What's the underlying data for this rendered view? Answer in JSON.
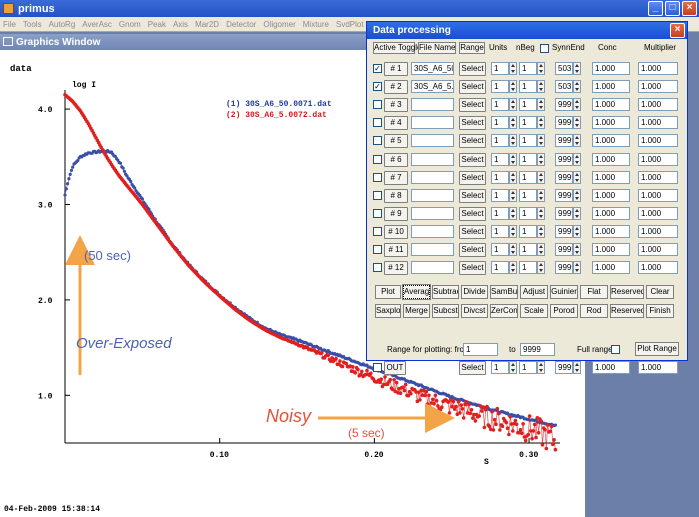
{
  "window": {
    "title": "primus"
  },
  "menu": [
    "File",
    "Tools",
    "AutoRg",
    "AverAsc",
    "Gnom",
    "Peak",
    "Axis",
    "Mar2D",
    "Detector",
    "Oligomer",
    "Mixture",
    "SvdPlot",
    "Bodies",
    "Save"
  ],
  "graphics": {
    "title": "Graphics Window",
    "data_label": "data",
    "log_label": "log I",
    "datetime": "04-Feb-2009   15:38:14",
    "legend": [
      {
        "text": "(1) 30S_A6_50.0071.dat",
        "color": "#1f3aa0"
      },
      {
        "text": "(2) 30S_A6_5.0072.dat",
        "color": "#d01818"
      }
    ],
    "annotations": {
      "exposure_long": "(50 sec)",
      "over_exposed": "Over-Exposed",
      "noisy": "Noisy",
      "exposure_short": "(5 sec)"
    },
    "colors": {
      "blue_series": "#3a4fa8",
      "red_series": "#e02020",
      "arrow": "#f2a447",
      "blue_text": "#4a63b8",
      "red_text": "#e8503a"
    }
  },
  "chart_data": {
    "type": "scatter",
    "title": "",
    "xlabel": "S",
    "ylabel": "log I",
    "xlim": [
      0.0,
      0.32
    ],
    "ylim": [
      0.5,
      4.2
    ],
    "x_ticks": [
      "0.10",
      "0.20",
      "0.30"
    ],
    "x_tick_values": [
      0.1,
      0.2,
      0.3
    ],
    "y_ticks": [
      "1.0",
      "2.0",
      "3.0",
      "4.0"
    ],
    "y_tick_values": [
      1.0,
      2.0,
      3.0,
      4.0
    ],
    "series": [
      {
        "name": "(1) 30S_A6_50.0071.dat",
        "color": "#3a4fa8",
        "points": [
          [
            0.0,
            3.1
          ],
          [
            0.002,
            3.25
          ],
          [
            0.005,
            3.4
          ],
          [
            0.01,
            3.5
          ],
          [
            0.015,
            3.54
          ],
          [
            0.02,
            3.55
          ],
          [
            0.025,
            3.56
          ],
          [
            0.03,
            3.55
          ],
          [
            0.035,
            3.45
          ],
          [
            0.04,
            3.3
          ],
          [
            0.05,
            3.05
          ],
          [
            0.06,
            2.8
          ],
          [
            0.07,
            2.57
          ],
          [
            0.08,
            2.37
          ],
          [
            0.09,
            2.2
          ],
          [
            0.1,
            2.05
          ],
          [
            0.11,
            1.92
          ],
          [
            0.12,
            1.8
          ],
          [
            0.13,
            1.7
          ],
          [
            0.14,
            1.63
          ],
          [
            0.15,
            1.58
          ],
          [
            0.16,
            1.52
          ],
          [
            0.17,
            1.46
          ],
          [
            0.18,
            1.4
          ],
          [
            0.19,
            1.34
          ],
          [
            0.2,
            1.28
          ],
          [
            0.21,
            1.22
          ],
          [
            0.22,
            1.16
          ],
          [
            0.23,
            1.1
          ],
          [
            0.24,
            1.04
          ],
          [
            0.25,
            0.98
          ],
          [
            0.26,
            0.93
          ],
          [
            0.27,
            0.88
          ],
          [
            0.28,
            0.83
          ],
          [
            0.29,
            0.79
          ],
          [
            0.3,
            0.75
          ],
          [
            0.31,
            0.71
          ],
          [
            0.317,
            0.68
          ]
        ]
      },
      {
        "name": "(2) 30S_A6_5.0072.dat",
        "color": "#e02020",
        "points": [
          [
            0.0,
            4.15
          ],
          [
            0.005,
            4.08
          ],
          [
            0.01,
            3.98
          ],
          [
            0.015,
            3.85
          ],
          [
            0.02,
            3.7
          ],
          [
            0.025,
            3.55
          ],
          [
            0.03,
            3.42
          ],
          [
            0.035,
            3.3
          ],
          [
            0.04,
            3.2
          ],
          [
            0.05,
            3.0
          ],
          [
            0.06,
            2.78
          ],
          [
            0.07,
            2.56
          ],
          [
            0.08,
            2.36
          ],
          [
            0.09,
            2.19
          ],
          [
            0.1,
            2.04
          ],
          [
            0.11,
            1.9
          ],
          [
            0.12,
            1.78
          ],
          [
            0.13,
            1.68
          ],
          [
            0.14,
            1.6
          ],
          [
            0.15,
            1.54
          ],
          [
            0.16,
            1.47
          ],
          [
            0.17,
            1.4
          ],
          [
            0.18,
            1.33
          ],
          [
            0.19,
            1.26
          ],
          [
            0.2,
            1.2
          ],
          [
            0.21,
            1.13
          ],
          [
            0.22,
            1.07
          ],
          [
            0.23,
            1.0
          ],
          [
            0.24,
            0.95
          ],
          [
            0.25,
            0.9
          ],
          [
            0.26,
            0.86
          ],
          [
            0.27,
            0.8
          ],
          [
            0.28,
            0.77
          ],
          [
            0.29,
            0.72
          ],
          [
            0.3,
            0.68
          ],
          [
            0.31,
            0.62
          ],
          [
            0.317,
            0.55
          ]
        ]
      }
    ],
    "grid": false,
    "legend": "top-right"
  },
  "dialog": {
    "title": "Data processing",
    "headers": {
      "toggle": "Active Toggle",
      "file": "File Name",
      "range": "Range",
      "units": "Units",
      "nbeg": "nBeg",
      "syn": "Syn",
      "nend": "nEnd",
      "conc": "Conc",
      "mult": "Multiplier"
    },
    "rows": [
      {
        "checked": true,
        "id": "# 1",
        "file": "30S_A6_50.",
        "select": "Select",
        "units": "1",
        "nbeg": "1",
        "nend": "503",
        "conc": "1.000",
        "mult": "1.000"
      },
      {
        "checked": true,
        "id": "# 2",
        "file": "30S_A6_5.0",
        "select": "Select",
        "units": "1",
        "nbeg": "1",
        "nend": "503",
        "conc": "1.000",
        "mult": "1.000"
      },
      {
        "checked": false,
        "id": "# 3",
        "file": "",
        "select": "Select",
        "units": "1",
        "nbeg": "1",
        "nend": "9999",
        "conc": "1.000",
        "mult": "1.000"
      },
      {
        "checked": false,
        "id": "# 4",
        "file": "",
        "select": "Select",
        "units": "1",
        "nbeg": "1",
        "nend": "9999",
        "conc": "1.000",
        "mult": "1.000"
      },
      {
        "checked": false,
        "id": "# 5",
        "file": "",
        "select": "Select",
        "units": "1",
        "nbeg": "1",
        "nend": "9999",
        "conc": "1.000",
        "mult": "1.000"
      },
      {
        "checked": false,
        "id": "# 6",
        "file": "",
        "select": "Select",
        "units": "1",
        "nbeg": "1",
        "nend": "9999",
        "conc": "1.000",
        "mult": "1.000"
      },
      {
        "checked": false,
        "id": "# 7",
        "file": "",
        "select": "Select",
        "units": "1",
        "nbeg": "1",
        "nend": "9999",
        "conc": "1.000",
        "mult": "1.000"
      },
      {
        "checked": false,
        "id": "# 8",
        "file": "",
        "select": "Select",
        "units": "1",
        "nbeg": "1",
        "nend": "9999",
        "conc": "1.000",
        "mult": "1.000"
      },
      {
        "checked": false,
        "id": "# 9",
        "file": "",
        "select": "Select",
        "units": "1",
        "nbeg": "1",
        "nend": "9999",
        "conc": "1.000",
        "mult": "1.000"
      },
      {
        "checked": false,
        "id": "# 10",
        "file": "",
        "select": "Select",
        "units": "1",
        "nbeg": "1",
        "nend": "9999",
        "conc": "1.000",
        "mult": "1.000"
      },
      {
        "checked": false,
        "id": "# 11",
        "file": "",
        "select": "Select",
        "units": "1",
        "nbeg": "1",
        "nend": "9999",
        "conc": "1.000",
        "mult": "1.000"
      },
      {
        "checked": false,
        "id": "# 12",
        "file": "",
        "select": "Select",
        "units": "1",
        "nbeg": "1",
        "nend": "9999",
        "conc": "1.000",
        "mult": "1.000"
      }
    ],
    "actions_row1": [
      "Plot",
      "Average",
      "Subtract",
      "Divide",
      "SamBuf",
      "Adjust",
      "Guinier",
      "Flat",
      "Reserved",
      "Clear"
    ],
    "actions_row2": [
      "Saxplot",
      "Merge",
      "Subcst",
      "Divcst",
      "ZerConc",
      "Scale",
      "Porod",
      "Rod",
      "Reserved",
      "Finish"
    ],
    "range": {
      "label": "Range for plotting: from",
      "from": "1",
      "to_label": "to",
      "to": "9999",
      "full_label": "Full range",
      "plot_range": "Plot Range"
    },
    "out": {
      "label": "OUT",
      "select": "Select",
      "units": "1",
      "nbeg": "1",
      "nend": "9999",
      "conc": "1.000",
      "mult": "1.000"
    }
  }
}
